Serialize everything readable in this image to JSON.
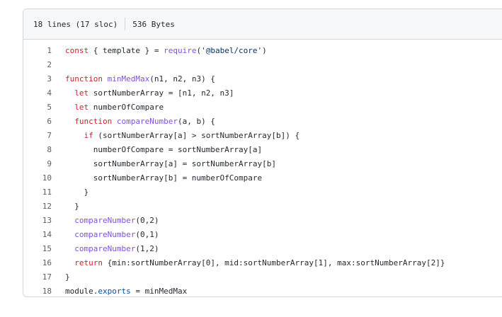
{
  "file_info": {
    "lines_label": "18 lines (17 sloc)",
    "size_label": "536 Bytes"
  },
  "code_lines": [
    {
      "n": "1",
      "text": "const { template } = require('@babel/core')"
    },
    {
      "n": "2",
      "text": ""
    },
    {
      "n": "3",
      "text": "function minMedMax(n1, n2, n3) {"
    },
    {
      "n": "4",
      "text": "  let sortNumberArray = [n1, n2, n3]"
    },
    {
      "n": "5",
      "text": "  let numberOfCompare"
    },
    {
      "n": "6",
      "text": "  function compareNumber(a, b) {"
    },
    {
      "n": "7",
      "text": "    if (sortNumberArray[a] > sortNumberArray[b]) {"
    },
    {
      "n": "8",
      "text": "      numberOfCompare = sortNumberArray[a]"
    },
    {
      "n": "9",
      "text": "      sortNumberArray[a] = sortNumberArray[b]"
    },
    {
      "n": "10",
      "text": "      sortNumberArray[b] = numberOfCompare"
    },
    {
      "n": "11",
      "text": "    }"
    },
    {
      "n": "12",
      "text": "  }"
    },
    {
      "n": "13",
      "text": "  compareNumber(0,2)"
    },
    {
      "n": "14",
      "text": "  compareNumber(0,1)"
    },
    {
      "n": "15",
      "text": "  compareNumber(1,2)"
    },
    {
      "n": "16",
      "text": "  return {min:sortNumberArray[0], mid:sortNumberArray[1], max:sortNumberArray[2]}"
    },
    {
      "n": "17",
      "text": "}"
    },
    {
      "n": "18",
      "text": "module.exports = minMedMax"
    }
  ]
}
